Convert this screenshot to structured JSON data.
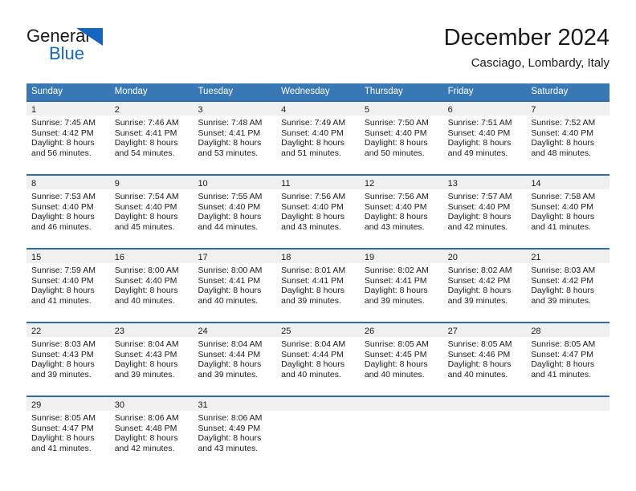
{
  "brand": {
    "name_part1": "General",
    "name_part2": "Blue",
    "accent_color": "#1565c0"
  },
  "header": {
    "month_title": "December 2024",
    "location": "Casciago, Lombardy, Italy"
  },
  "calendar": {
    "header_color": "#3878b4",
    "weekdays": [
      "Sunday",
      "Monday",
      "Tuesday",
      "Wednesday",
      "Thursday",
      "Friday",
      "Saturday"
    ],
    "weeks": [
      [
        {
          "day": "1",
          "sunrise": "Sunrise: 7:45 AM",
          "sunset": "Sunset: 4:42 PM",
          "daylight_line1": "Daylight: 8 hours",
          "daylight_line2": "and 56 minutes."
        },
        {
          "day": "2",
          "sunrise": "Sunrise: 7:46 AM",
          "sunset": "Sunset: 4:41 PM",
          "daylight_line1": "Daylight: 8 hours",
          "daylight_line2": "and 54 minutes."
        },
        {
          "day": "3",
          "sunrise": "Sunrise: 7:48 AM",
          "sunset": "Sunset: 4:41 PM",
          "daylight_line1": "Daylight: 8 hours",
          "daylight_line2": "and 53 minutes."
        },
        {
          "day": "4",
          "sunrise": "Sunrise: 7:49 AM",
          "sunset": "Sunset: 4:40 PM",
          "daylight_line1": "Daylight: 8 hours",
          "daylight_line2": "and 51 minutes."
        },
        {
          "day": "5",
          "sunrise": "Sunrise: 7:50 AM",
          "sunset": "Sunset: 4:40 PM",
          "daylight_line1": "Daylight: 8 hours",
          "daylight_line2": "and 50 minutes."
        },
        {
          "day": "6",
          "sunrise": "Sunrise: 7:51 AM",
          "sunset": "Sunset: 4:40 PM",
          "daylight_line1": "Daylight: 8 hours",
          "daylight_line2": "and 49 minutes."
        },
        {
          "day": "7",
          "sunrise": "Sunrise: 7:52 AM",
          "sunset": "Sunset: 4:40 PM",
          "daylight_line1": "Daylight: 8 hours",
          "daylight_line2": "and 48 minutes."
        }
      ],
      [
        {
          "day": "8",
          "sunrise": "Sunrise: 7:53 AM",
          "sunset": "Sunset: 4:40 PM",
          "daylight_line1": "Daylight: 8 hours",
          "daylight_line2": "and 46 minutes."
        },
        {
          "day": "9",
          "sunrise": "Sunrise: 7:54 AM",
          "sunset": "Sunset: 4:40 PM",
          "daylight_line1": "Daylight: 8 hours",
          "daylight_line2": "and 45 minutes."
        },
        {
          "day": "10",
          "sunrise": "Sunrise: 7:55 AM",
          "sunset": "Sunset: 4:40 PM",
          "daylight_line1": "Daylight: 8 hours",
          "daylight_line2": "and 44 minutes."
        },
        {
          "day": "11",
          "sunrise": "Sunrise: 7:56 AM",
          "sunset": "Sunset: 4:40 PM",
          "daylight_line1": "Daylight: 8 hours",
          "daylight_line2": "and 43 minutes."
        },
        {
          "day": "12",
          "sunrise": "Sunrise: 7:56 AM",
          "sunset": "Sunset: 4:40 PM",
          "daylight_line1": "Daylight: 8 hours",
          "daylight_line2": "and 43 minutes."
        },
        {
          "day": "13",
          "sunrise": "Sunrise: 7:57 AM",
          "sunset": "Sunset: 4:40 PM",
          "daylight_line1": "Daylight: 8 hours",
          "daylight_line2": "and 42 minutes."
        },
        {
          "day": "14",
          "sunrise": "Sunrise: 7:58 AM",
          "sunset": "Sunset: 4:40 PM",
          "daylight_line1": "Daylight: 8 hours",
          "daylight_line2": "and 41 minutes."
        }
      ],
      [
        {
          "day": "15",
          "sunrise": "Sunrise: 7:59 AM",
          "sunset": "Sunset: 4:40 PM",
          "daylight_line1": "Daylight: 8 hours",
          "daylight_line2": "and 41 minutes."
        },
        {
          "day": "16",
          "sunrise": "Sunrise: 8:00 AM",
          "sunset": "Sunset: 4:40 PM",
          "daylight_line1": "Daylight: 8 hours",
          "daylight_line2": "and 40 minutes."
        },
        {
          "day": "17",
          "sunrise": "Sunrise: 8:00 AM",
          "sunset": "Sunset: 4:41 PM",
          "daylight_line1": "Daylight: 8 hours",
          "daylight_line2": "and 40 minutes."
        },
        {
          "day": "18",
          "sunrise": "Sunrise: 8:01 AM",
          "sunset": "Sunset: 4:41 PM",
          "daylight_line1": "Daylight: 8 hours",
          "daylight_line2": "and 39 minutes."
        },
        {
          "day": "19",
          "sunrise": "Sunrise: 8:02 AM",
          "sunset": "Sunset: 4:41 PM",
          "daylight_line1": "Daylight: 8 hours",
          "daylight_line2": "and 39 minutes."
        },
        {
          "day": "20",
          "sunrise": "Sunrise: 8:02 AM",
          "sunset": "Sunset: 4:42 PM",
          "daylight_line1": "Daylight: 8 hours",
          "daylight_line2": "and 39 minutes."
        },
        {
          "day": "21",
          "sunrise": "Sunrise: 8:03 AM",
          "sunset": "Sunset: 4:42 PM",
          "daylight_line1": "Daylight: 8 hours",
          "daylight_line2": "and 39 minutes."
        }
      ],
      [
        {
          "day": "22",
          "sunrise": "Sunrise: 8:03 AM",
          "sunset": "Sunset: 4:43 PM",
          "daylight_line1": "Daylight: 8 hours",
          "daylight_line2": "and 39 minutes."
        },
        {
          "day": "23",
          "sunrise": "Sunrise: 8:04 AM",
          "sunset": "Sunset: 4:43 PM",
          "daylight_line1": "Daylight: 8 hours",
          "daylight_line2": "and 39 minutes."
        },
        {
          "day": "24",
          "sunrise": "Sunrise: 8:04 AM",
          "sunset": "Sunset: 4:44 PM",
          "daylight_line1": "Daylight: 8 hours",
          "daylight_line2": "and 39 minutes."
        },
        {
          "day": "25",
          "sunrise": "Sunrise: 8:04 AM",
          "sunset": "Sunset: 4:44 PM",
          "daylight_line1": "Daylight: 8 hours",
          "daylight_line2": "and 40 minutes."
        },
        {
          "day": "26",
          "sunrise": "Sunrise: 8:05 AM",
          "sunset": "Sunset: 4:45 PM",
          "daylight_line1": "Daylight: 8 hours",
          "daylight_line2": "and 40 minutes."
        },
        {
          "day": "27",
          "sunrise": "Sunrise: 8:05 AM",
          "sunset": "Sunset: 4:46 PM",
          "daylight_line1": "Daylight: 8 hours",
          "daylight_line2": "and 40 minutes."
        },
        {
          "day": "28",
          "sunrise": "Sunrise: 8:05 AM",
          "sunset": "Sunset: 4:47 PM",
          "daylight_line1": "Daylight: 8 hours",
          "daylight_line2": "and 41 minutes."
        }
      ],
      [
        {
          "day": "29",
          "sunrise": "Sunrise: 8:05 AM",
          "sunset": "Sunset: 4:47 PM",
          "daylight_line1": "Daylight: 8 hours",
          "daylight_line2": "and 41 minutes."
        },
        {
          "day": "30",
          "sunrise": "Sunrise: 8:06 AM",
          "sunset": "Sunset: 4:48 PM",
          "daylight_line1": "Daylight: 8 hours",
          "daylight_line2": "and 42 minutes."
        },
        {
          "day": "31",
          "sunrise": "Sunrise: 8:06 AM",
          "sunset": "Sunset: 4:49 PM",
          "daylight_line1": "Daylight: 8 hours",
          "daylight_line2": "and 43 minutes."
        },
        {
          "day": "",
          "sunrise": "",
          "sunset": "",
          "daylight_line1": "",
          "daylight_line2": ""
        },
        {
          "day": "",
          "sunrise": "",
          "sunset": "",
          "daylight_line1": "",
          "daylight_line2": ""
        },
        {
          "day": "",
          "sunrise": "",
          "sunset": "",
          "daylight_line1": "",
          "daylight_line2": ""
        },
        {
          "day": "",
          "sunrise": "",
          "sunset": "",
          "daylight_line1": "",
          "daylight_line2": ""
        }
      ]
    ]
  }
}
